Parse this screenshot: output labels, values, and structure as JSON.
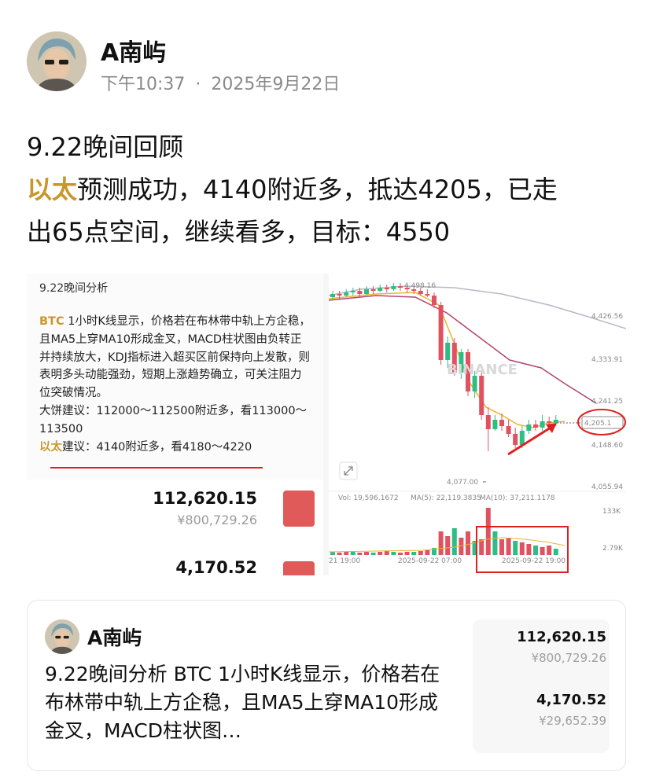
{
  "author": {
    "name": "A南屿",
    "time": "下午10:37",
    "separator": "·",
    "date": "2025年9月22日"
  },
  "post": {
    "line1": "9.22晚间回顾",
    "highlight": "以太",
    "line2": "预测成功，4140附近多，抵达4205，已走",
    "line3": "出65点空间，继续看多，目标：4550"
  },
  "note": {
    "title": "9.22晚间分析",
    "btc_tag": "BTC",
    "btc_text": " 1小时K线显示，价格若在布林带中轨上方企稳，且MA5上穿MA10形成金叉，MACD柱状图由负转正并持续放大，KDJ指标进入超买区前保持向上发散，则表明多头动能强劲，短期上涨趋势确立，可关注阻力位突破情况。",
    "big_advice": "大饼建议：112000～112500附近多，看113000～113500",
    "eth_tag": "以太",
    "eth_advice": "建议：4140附近多，看4180～4220",
    "btc_price": "112,620.15",
    "btc_cny": "¥800,729.26",
    "eth_price": "4,170.52"
  },
  "chart": {
    "watermark": "BINANCE",
    "high_label": "4,498.16",
    "low_label": "4,077.00",
    "current_label": "4,205.1",
    "y_ticks": [
      "4,426.56",
      "4,333.91",
      "4,241.25",
      "4,148.60",
      "4,055.94"
    ],
    "vol_label": "Vol: 19,596.1672",
    "ma5_label": "MA(5): 22,119.3835",
    "ma10_label": "MA(10): 37,211.1178",
    "vol_ticks": [
      "133K",
      "2.79K"
    ],
    "x_ticks": [
      "21 19:00",
      "2025-09-22 07:00",
      "2025-09-22 19:00"
    ],
    "colors": {
      "up": "#2ebd85",
      "down": "#e0525f",
      "ma_yellow": "#e9b530",
      "ma_purple": "#b0456e",
      "annot": "#e02020"
    }
  },
  "quote": {
    "name": "A南屿",
    "text": "9.22晚间分析 BTC 1小时K线显示，价格若在布林带中轨上方企稳，且MA5上穿MA10形成金叉，MACD柱状图…",
    "btc_price": "112,620.15",
    "btc_cny": "¥800,729.26",
    "eth_price": "4,170.52",
    "eth_cny": "¥29,652.39"
  }
}
